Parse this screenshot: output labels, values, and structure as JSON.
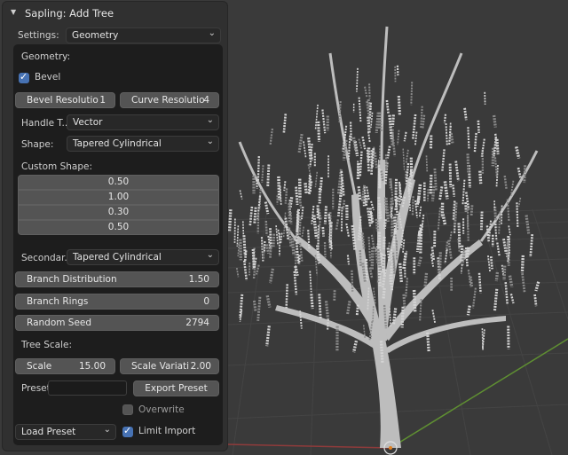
{
  "panel": {
    "title": "Sapling: Add Tree",
    "settings_label": "Settings:",
    "settings_value": "Geometry"
  },
  "geometry": {
    "heading": "Geometry:",
    "bevel_label": "Bevel",
    "bevel_checked": true,
    "bevel_resolution_label": "Bevel Resolutio",
    "bevel_resolution_value": "1",
    "curve_resolution_label": "Curve Resolutio",
    "curve_resolution_value": "4",
    "handle_type_label": "Handle T...",
    "handle_type_value": "Vector",
    "shape_label": "Shape:",
    "shape_value": "Tapered Cylindrical",
    "custom_shape_heading": "Custom Shape:",
    "custom_shape_values": [
      "0.50",
      "1.00",
      "0.30",
      "0.50"
    ],
    "secondary_label": "Secondar...",
    "secondary_value": "Tapered Cylindrical",
    "branch_distribution_label": "Branch Distribution",
    "branch_distribution_value": "1.50",
    "branch_rings_label": "Branch Rings",
    "branch_rings_value": "0",
    "random_seed_label": "Random Seed",
    "random_seed_value": "2794",
    "tree_scale_heading": "Tree Scale:",
    "scale_label": "Scale",
    "scale_value": "15.00",
    "scale_variation_label": "Scale Variati",
    "scale_variation_value": "2.00",
    "preset_label": "Preset",
    "preset_value": "",
    "export_preset_label": "Export Preset",
    "overwrite_label": "Overwrite",
    "overwrite_checked": false,
    "load_preset_label": "Load Preset",
    "limit_import_label": "Limit Import",
    "limit_import_checked": true
  },
  "colors": {
    "viewport_bg": "#3a3a3a",
    "panel_bg": "#303030",
    "accent_blue": "#4772b3",
    "tree_color": "#c8c8c8"
  },
  "icons": [
    "chevron-down-icon",
    "checkmark-icon",
    "collapse-triangle-icon",
    "object-origin-icon"
  ]
}
